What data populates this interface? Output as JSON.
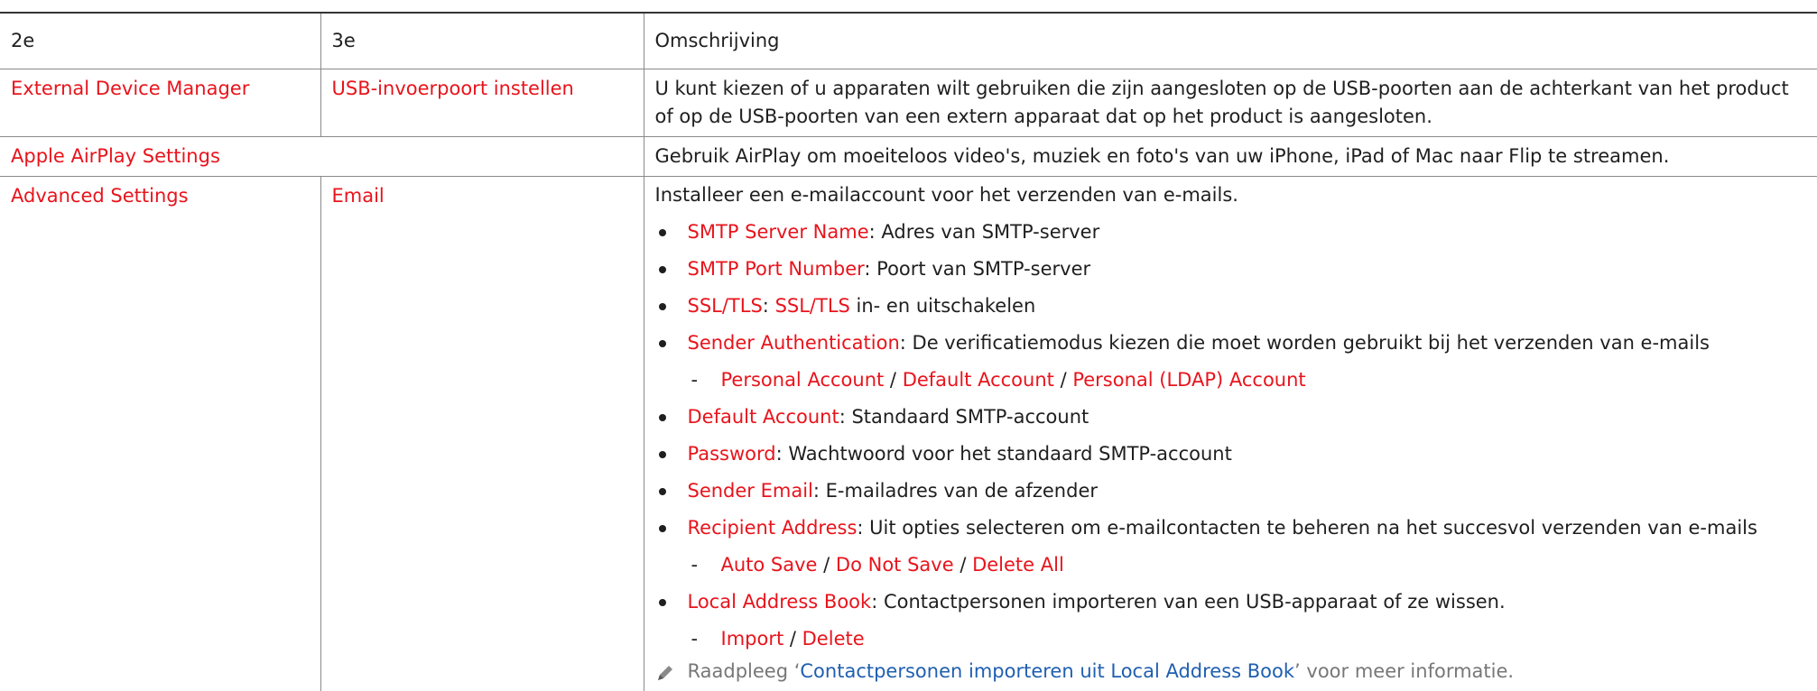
{
  "header": {
    "col1": "2e",
    "col2": "3e",
    "col3": "Omschrijving"
  },
  "row1": {
    "col1": "External Device Manager",
    "col2": "USB-invoerpoort instellen",
    "desc": "U kunt kiezen of u apparaten wilt gebruiken die zijn aangesloten op de USB-poorten aan de achterkant van het product of op de USB-poorten van een extern apparaat dat op het product is aangesloten."
  },
  "row2": {
    "col1": "Apple AirPlay Settings",
    "desc": "Gebruik AirPlay om moeiteloos video's, muziek en foto's van uw iPhone, iPad of Mac naar Flip te streamen."
  },
  "row3": {
    "col1": "Advanced Settings",
    "col2": "Email",
    "intro": "Installeer een e-mailaccount voor het verzenden van e-mails.",
    "smtp_name": {
      "term": "SMTP Server Name",
      "text": ": Adres van SMTP-server"
    },
    "smtp_port": {
      "term": "SMTP Port Number",
      "text": ": Poort van SMTP-server"
    },
    "ssl": {
      "term": "SSL/TLS",
      "sep": ": ",
      "term2": "SSL/TLS",
      "text": " in- en uitschakelen"
    },
    "sender_auth": {
      "term": "Sender Authentication",
      "text": ": De verificatiemodus kiezen die moet worden gebruikt bij het verzenden van e-mails"
    },
    "auth_options": {
      "dash": "-",
      "o1": "Personal Account",
      "s1": " / ",
      "o2": "Default Account",
      "s2": " / ",
      "o3": "Personal (LDAP) Account"
    },
    "default_account": {
      "term": "Default Account",
      "text": ": Standaard SMTP-account"
    },
    "password": {
      "term": "Password",
      "text": ": Wachtwoord voor het standaard SMTP-account"
    },
    "sender_email": {
      "term": "Sender Email",
      "text": ": E-mailadres van de afzender"
    },
    "recipient": {
      "term": "Recipient Address",
      "text": ": Uit opties selecteren om e-mailcontacten te beheren na het succesvol verzenden van e-mails"
    },
    "recipient_options": {
      "dash": "-",
      "o1": "Auto Save",
      "s1": " / ",
      "o2": "Do Not Save",
      "s2": " / ",
      "o3": "Delete All"
    },
    "address_book": {
      "term": "Local Address Book",
      "text": ": Contactpersonen importeren van een USB-apparaat of ze wissen."
    },
    "book_options": {
      "dash": "-",
      "o1": "Import",
      "s1": " / ",
      "o2": "Delete"
    },
    "note": {
      "pre": "Raadpleeg ‘",
      "link": "Contactpersonen importeren uit Local Address Book",
      "post": "’ voor meer informatie."
    }
  },
  "colors": {
    "accent": "#e8141c",
    "link": "#1f5fb0",
    "note": "#777777"
  },
  "icons": {
    "note": "pencil-icon"
  }
}
